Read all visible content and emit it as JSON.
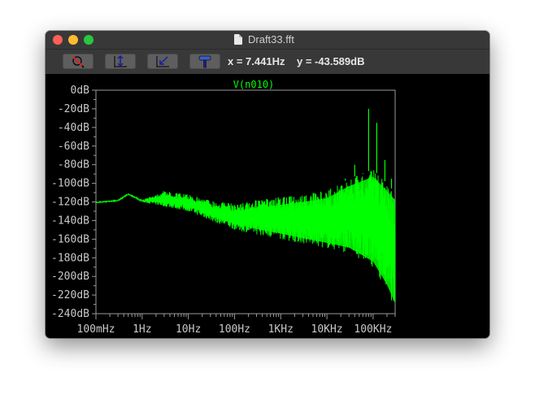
{
  "window": {
    "title": "Draft33.fft"
  },
  "toolbar": {
    "buttons": [
      {
        "name": "zoom-area"
      },
      {
        "name": "autorange-y"
      },
      {
        "name": "zoom-back"
      },
      {
        "name": "pan"
      }
    ],
    "x_readout": "x = 7.441Hz",
    "y_readout": "y = -43.589dB"
  },
  "colors": {
    "trace": "#00ff00",
    "axes": "#9a9a9a",
    "background": "#000000"
  },
  "chart_data": {
    "type": "line",
    "title": "V(n010)",
    "x_scale": "log",
    "xlim": [
      0.1,
      300000
    ],
    "ylim": [
      -240,
      0
    ],
    "grid": false,
    "y_ticks": [
      "0dB",
      "-20dB",
      "-40dB",
      "-60dB",
      "-80dB",
      "-100dB",
      "-120dB",
      "-140dB",
      "-160dB",
      "-180dB",
      "-200dB",
      "-220dB",
      "-240dB"
    ],
    "y_tick_values": [
      0,
      -20,
      -40,
      -60,
      -80,
      -100,
      -120,
      -140,
      -160,
      -180,
      -200,
      -220,
      -240
    ],
    "x_ticks": [
      "100mHz",
      "1Hz",
      "10Hz",
      "100Hz",
      "1KHz",
      "10KHz",
      "100KHz"
    ],
    "x_tick_values": [
      0.1,
      1,
      10,
      100,
      1000,
      10000,
      100000
    ],
    "series": [
      {
        "name": "V(n010)",
        "envelope": {
          "freq": [
            0.1,
            0.3,
            0.5,
            1,
            3,
            10,
            30,
            100,
            300,
            1000,
            3000,
            10000,
            30000,
            100000,
            200000,
            300000
          ],
          "upper": [
            -120,
            -118,
            -111,
            -118,
            -108,
            -112,
            -118,
            -122,
            -118,
            -115,
            -112,
            -108,
            -95,
            -85,
            -100,
            -110
          ],
          "lower": [
            -121,
            -119,
            -112,
            -120,
            -125,
            -130,
            -140,
            -150,
            -155,
            -160,
            -165,
            -170,
            -175,
            -190,
            -215,
            -235
          ]
        },
        "spikes": [
          {
            "freq": 12000,
            "db": -110
          },
          {
            "freq": 25000,
            "db": -95
          },
          {
            "freq": 40000,
            "db": -80
          },
          {
            "freq": 60000,
            "db": -90
          },
          {
            "freq": 80000,
            "db": -20
          },
          {
            "freq": 120000,
            "db": -35
          },
          {
            "freq": 180000,
            "db": -75
          },
          {
            "freq": 250000,
            "db": -95
          }
        ]
      }
    ]
  }
}
